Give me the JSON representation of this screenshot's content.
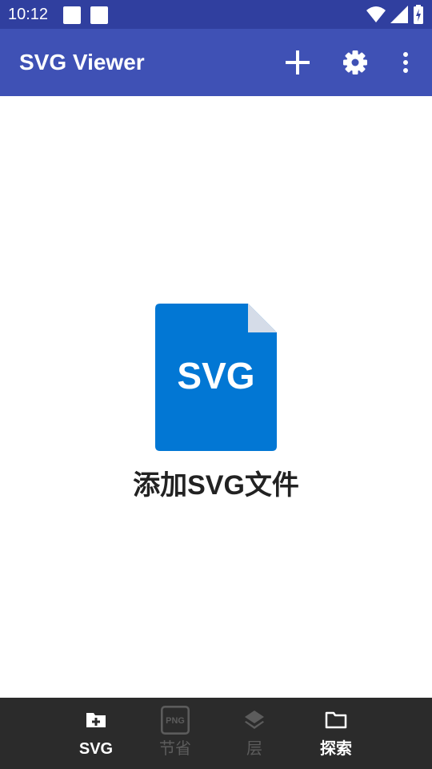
{
  "status_bar": {
    "time": "10:12",
    "icons": [
      "wifi-icon",
      "cell-signal-icon",
      "battery-charging-icon"
    ]
  },
  "app_bar": {
    "title": "SVG Viewer",
    "actions": [
      "add-icon",
      "settings-icon",
      "more-vertical-icon"
    ],
    "background_color": "#3F51B5",
    "status_color": "#303F9F"
  },
  "empty_state": {
    "icon_text": "SVG",
    "label": "添加SVG文件",
    "icon_color": "#0277D4"
  },
  "bottom_nav": {
    "items": [
      {
        "label": "SVG",
        "icon": "folder-add-icon",
        "active": true
      },
      {
        "label": "节省",
        "icon": "png-icon",
        "active": false
      },
      {
        "label": "层",
        "icon": "layers-icon",
        "active": false
      },
      {
        "label": "探索",
        "icon": "folder-icon",
        "active": true
      }
    ],
    "background_color": "#2b2b2b"
  }
}
